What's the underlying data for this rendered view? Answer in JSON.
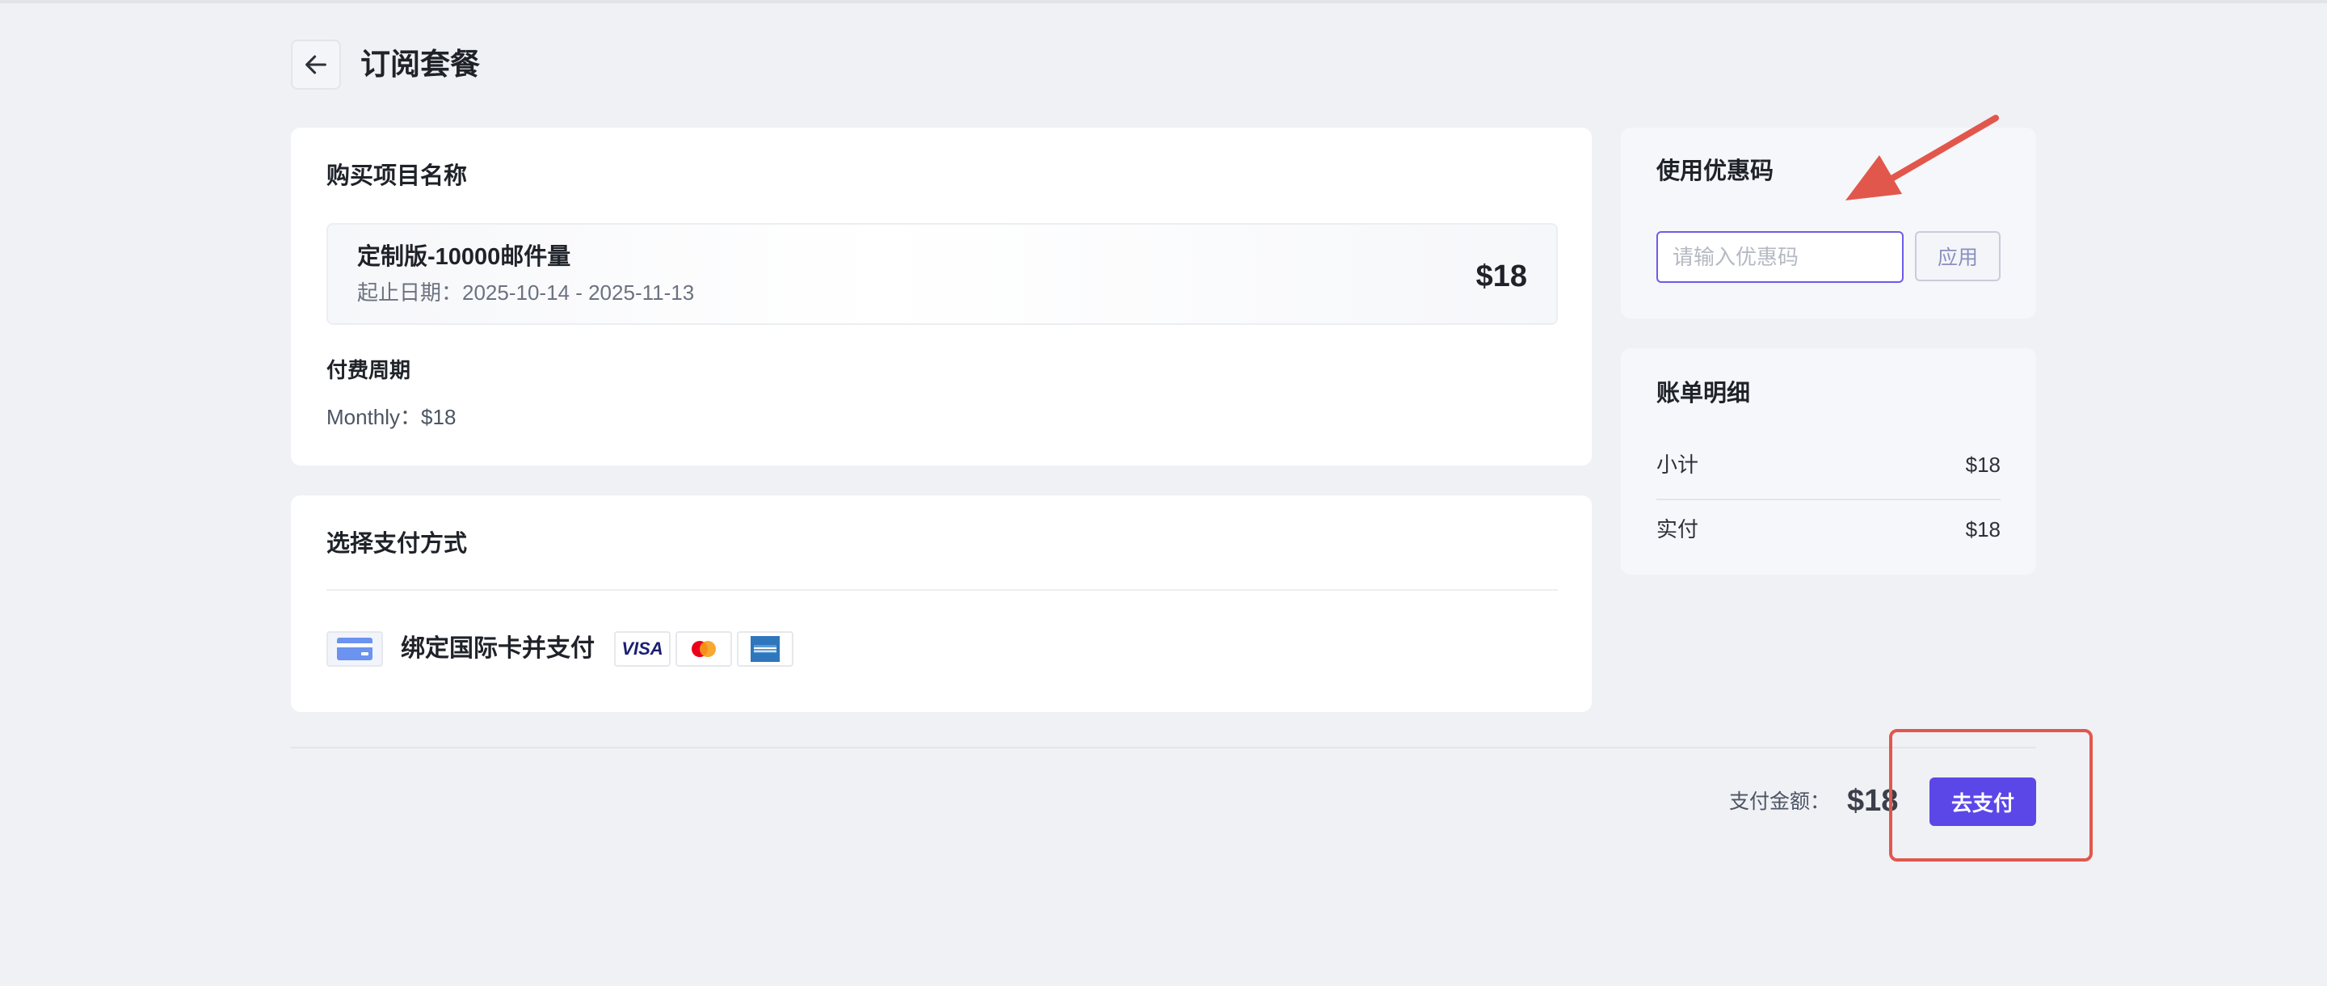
{
  "header": {
    "title": "订阅套餐"
  },
  "product": {
    "section_title": "购买项目名称",
    "name": "定制版-10000邮件量",
    "date": "起止日期：2025-10-14 - 2025-11-13",
    "price": "$18",
    "cycle_title": "付费周期",
    "cycle_value": "Monthly：$18"
  },
  "payment": {
    "section_title": "选择支付方式",
    "option_label": "绑定国际卡并支付",
    "brands": [
      "VISA",
      "mastercard",
      "amex"
    ]
  },
  "coupon": {
    "section_title": "使用优惠码",
    "placeholder": "请输入优惠码",
    "value": "",
    "apply_label": "应用"
  },
  "bill": {
    "section_title": "账单明细",
    "rows": [
      {
        "label": "小计",
        "value": "$18"
      },
      {
        "label": "实付",
        "value": "$18"
      }
    ]
  },
  "footer": {
    "amount_label": "支付金额：",
    "amount": "$18",
    "pay_button": "去支付"
  },
  "colors": {
    "accent": "#5b47e8",
    "annotation": "#e2574c",
    "background": "#f0f1f5"
  }
}
